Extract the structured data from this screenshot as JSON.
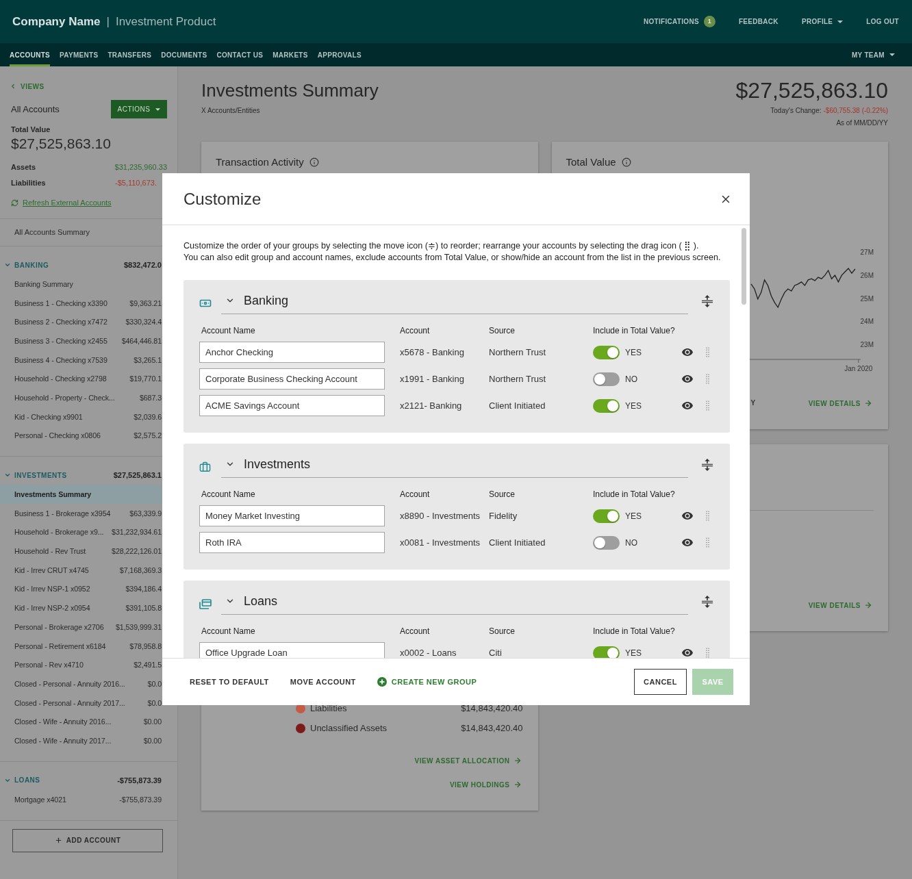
{
  "header": {
    "company": "Company Name",
    "separator": "|",
    "product": "Investment Product",
    "links": [
      {
        "kind": "notifications",
        "label": "NOTIFICATIONS",
        "badge": "1"
      },
      {
        "kind": "plain",
        "label": "FEEDBACK"
      },
      {
        "kind": "menu",
        "label": "PROFILE"
      },
      {
        "kind": "plain",
        "label": "LOG OUT"
      }
    ]
  },
  "nav": {
    "tabs": [
      {
        "label": "ACCOUNTS",
        "selected": true
      },
      {
        "label": "PAYMENTS",
        "selected": false
      },
      {
        "label": "TRANSFERS",
        "selected": false
      },
      {
        "label": "DOCUMENTS",
        "selected": false
      },
      {
        "label": "CONTACT US",
        "selected": false
      },
      {
        "label": "MARKETS",
        "selected": false
      },
      {
        "label": "APPROVALS",
        "selected": false
      }
    ],
    "team_menu": "MY TEAM"
  },
  "sidebar": {
    "views_link": "VIEWS",
    "title": "All Accounts",
    "actions_button": "ACTIONS",
    "total_label": "Total Value",
    "total_value": "$27,525,863.10",
    "balances": [
      {
        "kind": "asset",
        "label": "Assets",
        "value": "$31,235,960.33"
      },
      {
        "kind": "liability",
        "label": "Liabilities",
        "value": "-$5,110,673."
      }
    ],
    "refresh_link": "Refresh External Accounts",
    "summary_item": {
      "label": "All Accounts Summary",
      "selected": false
    },
    "groups": [
      {
        "label": "BANKING",
        "amount": "$832,472.0",
        "expanded": true,
        "items": [
          {
            "name": "Banking Summary",
            "selected": false
          },
          {
            "name": "Business 1 - Checking x3390",
            "amount": "$9,363.21",
            "selected": false
          },
          {
            "name": "Business 2 - Checking x7472",
            "amount": "$330,324.4",
            "selected": false
          },
          {
            "name": "Business 3 - Checking x2455",
            "amount": "$464,446.81",
            "selected": false
          },
          {
            "name": "Business 4 - Checking x7539",
            "amount": "$3,265.1",
            "selected": false
          },
          {
            "name": "Household - Checking x2798",
            "amount": "$19,770.1",
            "selected": false
          },
          {
            "name": "Household - Property - Check...",
            "amount": "$687.3",
            "selected": false
          },
          {
            "name": "Kid - Checking x9901",
            "amount": "$2,039.6",
            "selected": false
          },
          {
            "name": "Personal - Checking x0806",
            "amount": "$2,575.2",
            "selected": false
          }
        ]
      },
      {
        "label": "INVESTMENTS",
        "amount": "$27,525,863.1",
        "expanded": true,
        "items": [
          {
            "name": "Investments Summary",
            "selected": true
          },
          {
            "name": "Business 1 - Brokerage x3954",
            "amount": "$63,339.9",
            "selected": false
          },
          {
            "name": "Household - Brokerage x9...",
            "amount": "$31,232,934.61",
            "selected": false
          },
          {
            "name": "Household - Rev Trust",
            "amount": "$28,222,126.01",
            "selected": false
          },
          {
            "name": "Kid - Irrev CRUT x4745",
            "amount": "$7,168,369.3",
            "selected": false
          },
          {
            "name": "Kid - Irrev NSP-1 x0952",
            "amount": "$394,186.4",
            "selected": false
          },
          {
            "name": "Kid - Irrev NSP-2 x0954",
            "amount": "$391,105.8",
            "selected": false
          },
          {
            "name": "Personal - Brokerage x2706",
            "amount": "$1,539,999.31",
            "selected": false
          },
          {
            "name": "Personal - Retirement x6184",
            "amount": "$78,958.8",
            "selected": false
          },
          {
            "name": "Personal - Rev x4710",
            "amount": "$2,491.5",
            "selected": false
          },
          {
            "name": "Closed - Personal - Annuity 2016...",
            "amount": "$0.0",
            "selected": false
          },
          {
            "name": "Closed - Personal - Annuity 2017...",
            "amount": "$0.0",
            "selected": false
          },
          {
            "name": "Closed - Wife - Annuity 2016...",
            "amount": "$0.00",
            "selected": false
          },
          {
            "name": "Closed - Wife - Annuity 2017...",
            "amount": "$0.00",
            "selected": false
          }
        ]
      },
      {
        "label": "LOANS",
        "amount": "-$755,873.39",
        "expanded": true,
        "items": [
          {
            "name": "Mortgage x4021",
            "amount": "-$755,873.39",
            "selected": false
          }
        ]
      }
    ],
    "add_button": "ADD ACCOUNT"
  },
  "main": {
    "title": "Investments Summary",
    "subtitle": "X Accounts/Entities",
    "total": "$27,525,863.10",
    "change_label": "Today's Change:",
    "change_value": "-$60,755.38 (-0.22%)",
    "as_of": "As of MM/DD/YY",
    "transaction_card": {
      "title": "Transaction Activity",
      "legend": [
        {
          "label": "Liabilities",
          "value": "$14,843,420.40",
          "color": "#c65a44"
        },
        {
          "label": "Unclassified Assets",
          "value": "$14,843,420.40",
          "color": "#7d1a1a"
        }
      ],
      "links": [
        "VIEW ASSET ALLOCATION",
        "VIEW HOLDINGS"
      ]
    },
    "total_value_card": {
      "title": "Total Value",
      "chart_data": {
        "type": "line",
        "ylim": [
          22.35,
          27
        ],
        "yticks": [
          {
            "value": 27,
            "label": "27M"
          },
          {
            "value": 26,
            "label": "26M"
          },
          {
            "value": 25,
            "label": "25M"
          },
          {
            "value": 24,
            "label": "24M"
          },
          {
            "value": 23,
            "label": "23M"
          }
        ],
        "series": [
          {
            "color": "#1f1f1f",
            "values": [
              25.61,
              25.4,
              24.96,
              25.25,
              25.79,
              25.55,
              25.1,
              24.81,
              24.6,
              24.96,
              25.25,
              25.4,
              25.31,
              25.55,
              25.61,
              25.7,
              25.55,
              25.79,
              25.84,
              25.76,
              25.9,
              25.84,
              25.99,
              26.2,
              25.84,
              25.99,
              25.7,
              25.99,
              26.14,
              26.29,
              26.08,
              26.26
            ]
          }
        ]
      },
      "axis_date": "Jan 2020",
      "link_fragment": "Y",
      "link": "VIEW DETAILS"
    },
    "details_card": {
      "link": "VIEW DETAILS"
    }
  },
  "modal": {
    "title": "Customize",
    "description": [
      "Customize the order of your groups by selecting the move icon (≑) to reorder; rearrange your accounts by selecting the drag icon ( ⣿ ).",
      "You can also edit group and account names, exclude accounts from Total Value, or show/hide an account from the list in the previous screen."
    ],
    "groups": [
      {
        "kind": "banking",
        "name": "Banking",
        "expanded": true,
        "columns": [
          "Account Name",
          "Account",
          "Source",
          "Include in Total Value?"
        ],
        "accounts": [
          {
            "name": "Anchor Checking",
            "account": "x5678 - Banking",
            "source": "Northern Trust",
            "included": true,
            "included_label": "YES",
            "shown": true
          },
          {
            "name": "Corporate Business Checking Account",
            "account": "x1991 - Banking",
            "source": "Northern Trust",
            "included": false,
            "included_label": "NO",
            "shown": true
          },
          {
            "name": "ACME Savings Account",
            "account": "x2121- Banking",
            "source": "Client Initiated",
            "included": true,
            "included_label": "YES",
            "shown": true
          }
        ]
      },
      {
        "kind": "investments",
        "name": "Investments",
        "expanded": true,
        "columns": [
          "Account Name",
          "Account",
          "Source",
          "Include in Total Value?"
        ],
        "accounts": [
          {
            "name": "Money Market Investing",
            "account": "x8890 - Investments",
            "source": "Fidelity",
            "included": true,
            "included_label": "YES",
            "shown": true
          },
          {
            "name": "Roth IRA",
            "account": "x0081 - Investments",
            "source": "Client Initiated",
            "included": false,
            "included_label": "NO",
            "shown": true
          }
        ]
      },
      {
        "kind": "loans",
        "name": "Loans",
        "expanded": true,
        "columns": [
          "Account Name",
          "Account",
          "Source",
          "Include in Total Value?"
        ],
        "accounts": [
          {
            "name": "Office Upgrade Loan",
            "account": "x0002 - Loans",
            "source": "Citi",
            "included": true,
            "included_label": "YES",
            "shown": true
          }
        ]
      }
    ],
    "footer": {
      "actions": [
        {
          "kind": "text",
          "label": "RESET TO DEFAULT"
        },
        {
          "kind": "text",
          "label": "MOVE ACCOUNT"
        },
        {
          "kind": "create",
          "label": "CREATE NEW GROUP"
        }
      ],
      "cancel": "CANCEL",
      "save": {
        "label": "SAVE",
        "disabled": true
      }
    }
  }
}
